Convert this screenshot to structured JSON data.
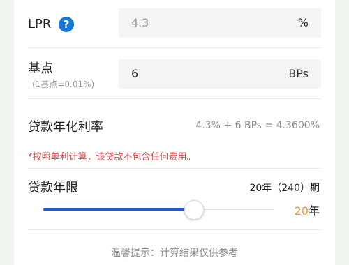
{
  "lpr": {
    "label": "LPR",
    "help_icon": "question-icon",
    "value": "4.3",
    "unit": "%"
  },
  "basis": {
    "label": "基点",
    "sublabel": "(1基点=0.01%)",
    "value": "6",
    "unit": "BPs"
  },
  "annual_rate": {
    "label": "贷款年化利率",
    "value": "4.3% + 6 BPs = 4.3600%"
  },
  "note": "*按照单利计算，该贷款不包含任何费用。",
  "term": {
    "label": "贷款年限",
    "summary": "20年（240）期",
    "years_value": "20",
    "years_unit": "年",
    "slider_fraction": 0.65
  },
  "tip": "温馨提示：计算结果仅供参考",
  "colors": {
    "accent": "#1e5bd0",
    "help_blue": "#1677d6",
    "warning_red": "#e04848",
    "orange": "#e8962a",
    "background": "#eef6ee"
  }
}
